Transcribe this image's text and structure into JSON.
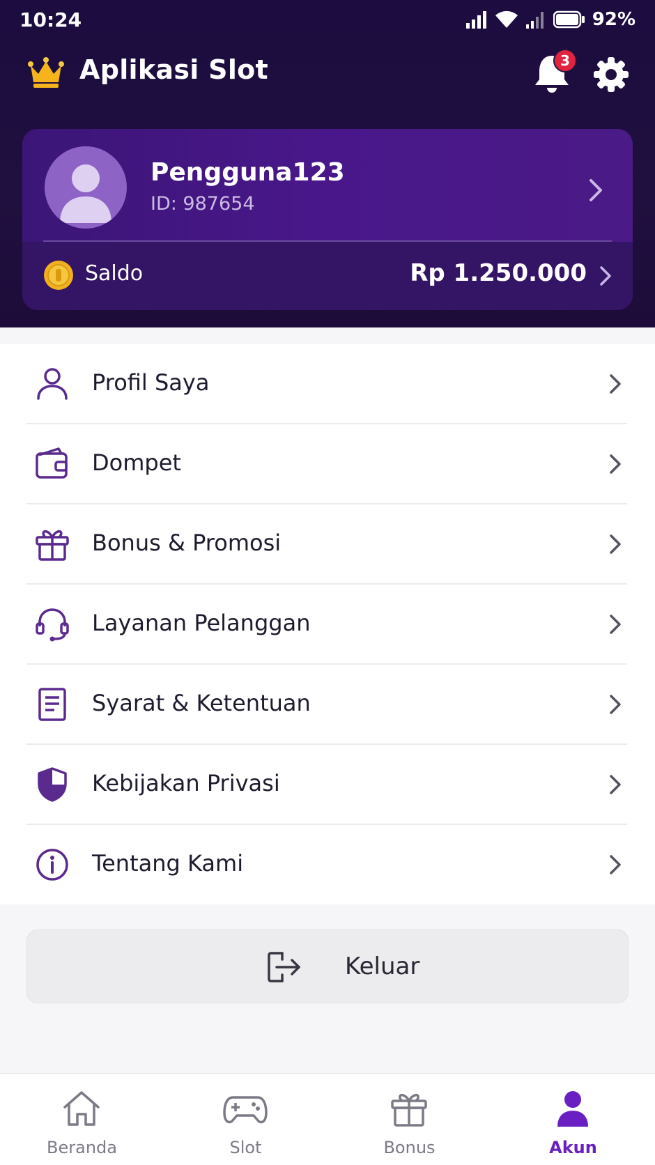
{
  "status_bar": {
    "time": "10:24",
    "battery": "92%"
  },
  "header": {
    "app_title": "Aplikasi Slot",
    "notification_count": "3"
  },
  "profile": {
    "username": "Pengguna123",
    "user_id": "ID: 987654",
    "balance_label": "Saldo",
    "balance_value": "Rp 1.250.000"
  },
  "menu": {
    "items": [
      {
        "label": "Profil Saya",
        "icon": "user-icon"
      },
      {
        "label": "Dompet",
        "icon": "wallet-icon"
      },
      {
        "label": "Bonus & Promosi",
        "icon": "gift-icon"
      },
      {
        "label": "Layanan Pelanggan",
        "icon": "headset-icon"
      },
      {
        "label": "Syarat & Ketentuan",
        "icon": "document-icon"
      },
      {
        "label": "Kebijakan Privasi",
        "icon": "shield-icon"
      },
      {
        "label": "Tentang Kami",
        "icon": "info-icon"
      }
    ]
  },
  "logout": {
    "label": "Keluar"
  },
  "bottom_nav": {
    "items": [
      {
        "label": "Beranda",
        "icon": "home-icon",
        "active": false
      },
      {
        "label": "Slot",
        "icon": "gamepad-icon",
        "active": false
      },
      {
        "label": "Bonus",
        "icon": "gift-icon",
        "active": false
      },
      {
        "label": "Akun",
        "icon": "user-icon",
        "active": true
      }
    ]
  },
  "colors": {
    "header_bg": "#1c0c3f",
    "card_bg": "#49178a",
    "accent": "#6a1fc2",
    "icon_purple": "#5b2a8f",
    "badge_red": "#e0243f",
    "coin_gold": "#f2b01e"
  }
}
